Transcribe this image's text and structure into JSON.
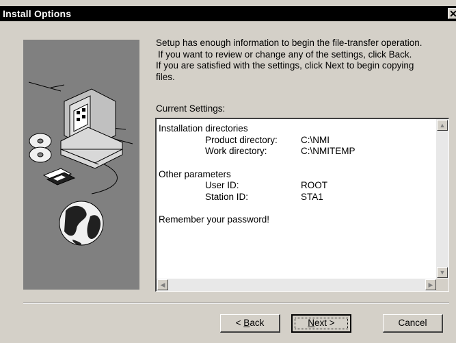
{
  "window": {
    "title": "Install Options",
    "close_glyph": "✕"
  },
  "intro": {
    "line1": "Setup has enough information to begin the file-transfer operation.",
    "line2": "If you want to review or change any of the settings, click Back.",
    "line3": "If you are satisfied with the settings, click Next to begin copying",
    "line4": "files."
  },
  "current_settings_label": "Current Settings:",
  "settings": {
    "installation_header": "Installation directories",
    "product_dir_label": "Product directory:",
    "product_dir_value": "C:\\NMI",
    "work_dir_label": "Work directory:",
    "work_dir_value": "C:\\NMITEMP",
    "other_header": "Other parameters",
    "user_id_label": "User ID:",
    "user_id_value": "ROOT",
    "station_id_label": "Station ID:",
    "station_id_value": "STA1",
    "reminder": "Remember your password!"
  },
  "scroll_icons": {
    "up": "▲",
    "down": "▼",
    "left": "◀",
    "right": "▶"
  },
  "buttons": {
    "back_prefix": "< ",
    "back_accel": "B",
    "back_rest": "ack",
    "next_accel": "N",
    "next_rest": "ext >",
    "cancel": "Cancel"
  },
  "colors": {
    "titlebar": "#000000",
    "face": "#d4d0c8",
    "art_bg": "#808080"
  },
  "icons": [
    "computer-illustration",
    "cd-icon",
    "floppy-icon",
    "globe-icon"
  ]
}
